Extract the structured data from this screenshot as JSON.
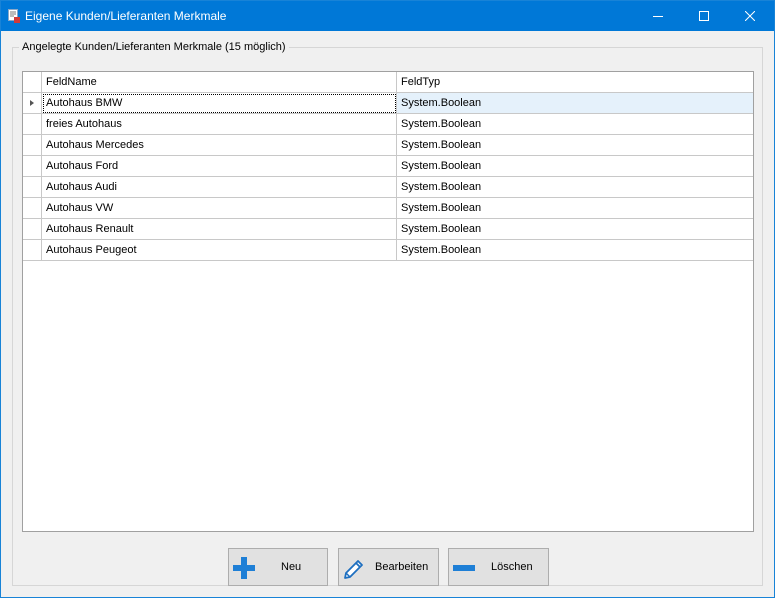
{
  "window": {
    "title": "Eigene Kunden/Lieferanten Merkmale"
  },
  "group": {
    "label": "Angelegte Kunden/Lieferanten Merkmale (15 möglich)"
  },
  "grid": {
    "columns": [
      "FeldName",
      "FeldTyp"
    ],
    "rows": [
      {
        "name": "Autohaus BMW",
        "type": "System.Boolean"
      },
      {
        "name": "freies Autohaus",
        "type": "System.Boolean"
      },
      {
        "name": "Autohaus Mercedes",
        "type": "System.Boolean"
      },
      {
        "name": "Autohaus Ford",
        "type": "System.Boolean"
      },
      {
        "name": "Autohaus Audi",
        "type": "System.Boolean"
      },
      {
        "name": "Autohaus VW",
        "type": "System.Boolean"
      },
      {
        "name": "Autohaus Renault",
        "type": "System.Boolean"
      },
      {
        "name": "Autohaus Peugeot",
        "type": "System.Boolean"
      }
    ],
    "current_row": 0
  },
  "buttons": {
    "neu": {
      "label": "Neu",
      "icon": "plus-icon"
    },
    "bearbeiten": {
      "label": "Bearbeiten",
      "icon": "pencil-icon"
    },
    "loeschen": {
      "label": "Löschen",
      "icon": "minus-icon"
    }
  },
  "colors": {
    "titlebar": "#0078d7",
    "icon_blue": "#1e7fd6",
    "selection": "#e5f1fb"
  }
}
